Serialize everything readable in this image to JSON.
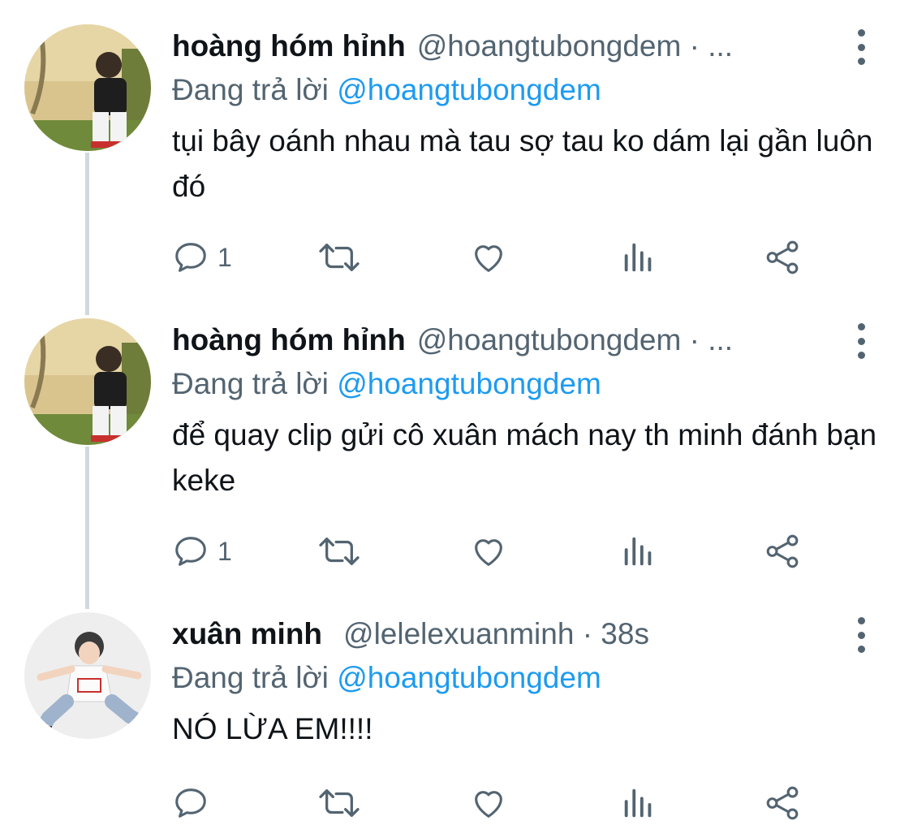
{
  "tweets": [
    {
      "name": "hoàng hóm hỉnh",
      "handle": "@hoangtubongdem · ...",
      "replying_prefix": "Đang trả lời",
      "replying_to": "@hoangtubongdem",
      "text": "tụi bây oánh nhau mà tau sợ tau ko dám lại gần luôn đó",
      "reply_count": "1"
    },
    {
      "name": "hoàng hóm hỉnh",
      "handle": "@hoangtubongdem · ...",
      "replying_prefix": "Đang trả lời",
      "replying_to": "@hoangtubongdem",
      "text": "để quay clip gửi cô xuân mách nay th minh đánh bạn keke",
      "reply_count": "1"
    },
    {
      "name": "xuân minh",
      "handle": "@lelelexuanminh · 38s",
      "replying_prefix": "Đang trả lời",
      "replying_to": "@hoangtubongdem",
      "text": "NÓ LỪA EM!!!!",
      "reply_count": ""
    }
  ],
  "icons": {
    "reply": "speech-bubble-icon",
    "retweet": "retweet-icon",
    "like": "heart-icon",
    "views": "bar-chart-icon",
    "share": "share-icon",
    "more": "vertical-ellipsis-icon"
  },
  "colors": {
    "text": "#0f1419",
    "secondary": "#536471",
    "link": "#1d9bf0",
    "thread_line": "#cfd9de"
  }
}
